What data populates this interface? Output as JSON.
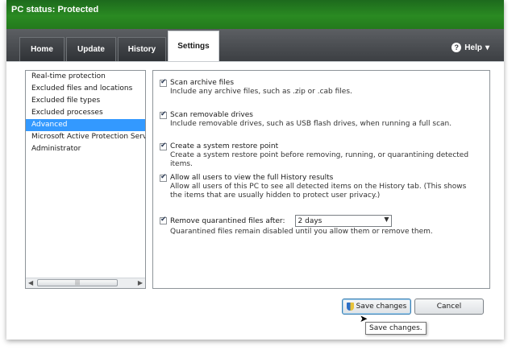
{
  "window": {
    "status_title": "PC status: Protected"
  },
  "tabs": [
    {
      "label": "Home",
      "active": false
    },
    {
      "label": "Update",
      "active": false
    },
    {
      "label": "History",
      "active": false
    },
    {
      "label": "Settings",
      "active": true
    }
  ],
  "help": {
    "label": "Help"
  },
  "sidebar": {
    "items": [
      {
        "label": "Real-time protection"
      },
      {
        "label": "Excluded files and locations"
      },
      {
        "label": "Excluded file types"
      },
      {
        "label": "Excluded processes"
      },
      {
        "label": "Advanced"
      },
      {
        "label": "Microsoft Active Protection Service"
      },
      {
        "label": "Administrator"
      }
    ],
    "selected": "Advanced",
    "scrollbar_thumb": "|||"
  },
  "options": [
    {
      "label": "Scan archive files",
      "checked": true,
      "desc": "Include any archive files, such as .zip or .cab files."
    },
    {
      "label": "Scan removable drives",
      "checked": true,
      "desc": "Include removable drives, such as USB flash drives, when running a full scan."
    },
    {
      "label": "Create a system restore point",
      "checked": true,
      "desc": "Create a system restore point before removing, running, or quarantining detected items."
    },
    {
      "label": "Allow all users to view the full History results",
      "checked": true,
      "desc": "Allow all users of this PC to see all detected items on the History tab. (This shows the items that are usually hidden to protect user privacy.)"
    },
    {
      "label": "Remove quarantined files after:",
      "checked": true,
      "desc": "Quarantined files remain disabled until you allow them or remove them.",
      "select_value": "2 days"
    }
  ],
  "buttons": {
    "save_label": "Save changes",
    "cancel_label": "Cancel"
  },
  "tooltip": {
    "text": "Save changes."
  },
  "colors": {
    "status_green": "#2a8a22",
    "header_dark": "#3c3f43",
    "selection_blue": "#3399ff"
  }
}
